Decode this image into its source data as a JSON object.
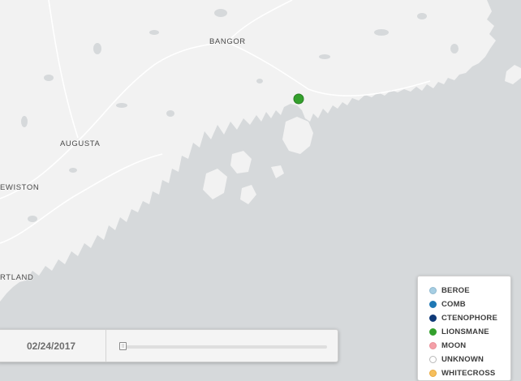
{
  "map": {
    "cities": [
      {
        "key": "bangor",
        "label": "BANGOR"
      },
      {
        "key": "augusta",
        "label": "AUGUSTA"
      },
      {
        "key": "lewiston",
        "label": "EWISTON"
      },
      {
        "key": "portland",
        "label": "RTLAND"
      }
    ],
    "colors": {
      "water": "#d6d9db",
      "land": "#f2f2f2",
      "lakes": "#d6d9db",
      "roads": "#ffffff"
    }
  },
  "timebar": {
    "date": "02/24/2017",
    "slider_position_fraction": 0.0,
    "handle_glyph": "||"
  },
  "sightings": [
    {
      "species": "LIONSMANE",
      "color": "#33a02c"
    }
  ],
  "legend": {
    "items": [
      {
        "label": "BEROE",
        "color": "#a6cee3",
        "border": "#8fb8cf"
      },
      {
        "label": "COMB",
        "color": "#1f78b4",
        "border": "#1f78b4"
      },
      {
        "label": "CTENOPHORE",
        "color": "#0f3a78",
        "border": "#0f3a78"
      },
      {
        "label": "LIONSMANE",
        "color": "#33a02c",
        "border": "#33a02c"
      },
      {
        "label": "MOON",
        "color": "#f4a0a8",
        "border": "#e88e97"
      },
      {
        "label": "UNKNOWN",
        "color": "#ffffff",
        "border": "#b8b8b8"
      },
      {
        "label": "WHITECROSS",
        "color": "#f6bf5d",
        "border": "#e8a93f"
      }
    ]
  }
}
